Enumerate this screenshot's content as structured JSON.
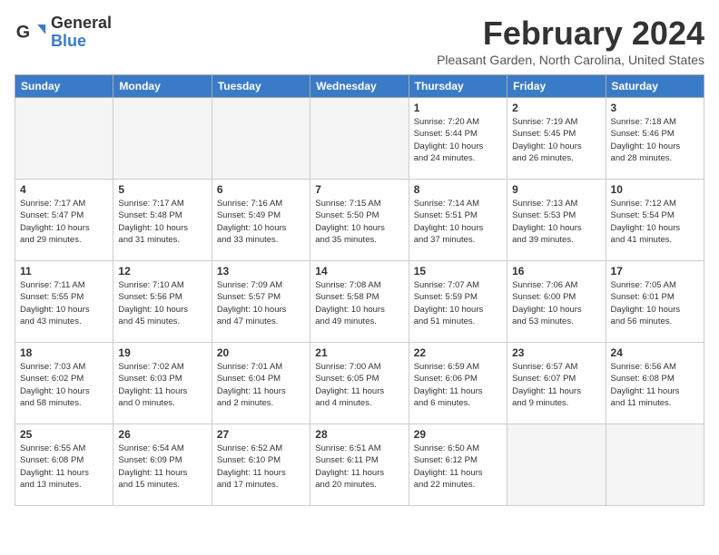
{
  "header": {
    "logo_general": "General",
    "logo_blue": "Blue",
    "month_title": "February 2024",
    "location": "Pleasant Garden, North Carolina, United States"
  },
  "days_of_week": [
    "Sunday",
    "Monday",
    "Tuesday",
    "Wednesday",
    "Thursday",
    "Friday",
    "Saturday"
  ],
  "weeks": [
    [
      {
        "num": "",
        "info": ""
      },
      {
        "num": "",
        "info": ""
      },
      {
        "num": "",
        "info": ""
      },
      {
        "num": "",
        "info": ""
      },
      {
        "num": "1",
        "info": "Sunrise: 7:20 AM\nSunset: 5:44 PM\nDaylight: 10 hours\nand 24 minutes."
      },
      {
        "num": "2",
        "info": "Sunrise: 7:19 AM\nSunset: 5:45 PM\nDaylight: 10 hours\nand 26 minutes."
      },
      {
        "num": "3",
        "info": "Sunrise: 7:18 AM\nSunset: 5:46 PM\nDaylight: 10 hours\nand 28 minutes."
      }
    ],
    [
      {
        "num": "4",
        "info": "Sunrise: 7:17 AM\nSunset: 5:47 PM\nDaylight: 10 hours\nand 29 minutes."
      },
      {
        "num": "5",
        "info": "Sunrise: 7:17 AM\nSunset: 5:48 PM\nDaylight: 10 hours\nand 31 minutes."
      },
      {
        "num": "6",
        "info": "Sunrise: 7:16 AM\nSunset: 5:49 PM\nDaylight: 10 hours\nand 33 minutes."
      },
      {
        "num": "7",
        "info": "Sunrise: 7:15 AM\nSunset: 5:50 PM\nDaylight: 10 hours\nand 35 minutes."
      },
      {
        "num": "8",
        "info": "Sunrise: 7:14 AM\nSunset: 5:51 PM\nDaylight: 10 hours\nand 37 minutes."
      },
      {
        "num": "9",
        "info": "Sunrise: 7:13 AM\nSunset: 5:53 PM\nDaylight: 10 hours\nand 39 minutes."
      },
      {
        "num": "10",
        "info": "Sunrise: 7:12 AM\nSunset: 5:54 PM\nDaylight: 10 hours\nand 41 minutes."
      }
    ],
    [
      {
        "num": "11",
        "info": "Sunrise: 7:11 AM\nSunset: 5:55 PM\nDaylight: 10 hours\nand 43 minutes."
      },
      {
        "num": "12",
        "info": "Sunrise: 7:10 AM\nSunset: 5:56 PM\nDaylight: 10 hours\nand 45 minutes."
      },
      {
        "num": "13",
        "info": "Sunrise: 7:09 AM\nSunset: 5:57 PM\nDaylight: 10 hours\nand 47 minutes."
      },
      {
        "num": "14",
        "info": "Sunrise: 7:08 AM\nSunset: 5:58 PM\nDaylight: 10 hours\nand 49 minutes."
      },
      {
        "num": "15",
        "info": "Sunrise: 7:07 AM\nSunset: 5:59 PM\nDaylight: 10 hours\nand 51 minutes."
      },
      {
        "num": "16",
        "info": "Sunrise: 7:06 AM\nSunset: 6:00 PM\nDaylight: 10 hours\nand 53 minutes."
      },
      {
        "num": "17",
        "info": "Sunrise: 7:05 AM\nSunset: 6:01 PM\nDaylight: 10 hours\nand 56 minutes."
      }
    ],
    [
      {
        "num": "18",
        "info": "Sunrise: 7:03 AM\nSunset: 6:02 PM\nDaylight: 10 hours\nand 58 minutes."
      },
      {
        "num": "19",
        "info": "Sunrise: 7:02 AM\nSunset: 6:03 PM\nDaylight: 11 hours\nand 0 minutes."
      },
      {
        "num": "20",
        "info": "Sunrise: 7:01 AM\nSunset: 6:04 PM\nDaylight: 11 hours\nand 2 minutes."
      },
      {
        "num": "21",
        "info": "Sunrise: 7:00 AM\nSunset: 6:05 PM\nDaylight: 11 hours\nand 4 minutes."
      },
      {
        "num": "22",
        "info": "Sunrise: 6:59 AM\nSunset: 6:06 PM\nDaylight: 11 hours\nand 6 minutes."
      },
      {
        "num": "23",
        "info": "Sunrise: 6:57 AM\nSunset: 6:07 PM\nDaylight: 11 hours\nand 9 minutes."
      },
      {
        "num": "24",
        "info": "Sunrise: 6:56 AM\nSunset: 6:08 PM\nDaylight: 11 hours\nand 11 minutes."
      }
    ],
    [
      {
        "num": "25",
        "info": "Sunrise: 6:55 AM\nSunset: 6:08 PM\nDaylight: 11 hours\nand 13 minutes."
      },
      {
        "num": "26",
        "info": "Sunrise: 6:54 AM\nSunset: 6:09 PM\nDaylight: 11 hours\nand 15 minutes."
      },
      {
        "num": "27",
        "info": "Sunrise: 6:52 AM\nSunset: 6:10 PM\nDaylight: 11 hours\nand 17 minutes."
      },
      {
        "num": "28",
        "info": "Sunrise: 6:51 AM\nSunset: 6:11 PM\nDaylight: 11 hours\nand 20 minutes."
      },
      {
        "num": "29",
        "info": "Sunrise: 6:50 AM\nSunset: 6:12 PM\nDaylight: 11 hours\nand 22 minutes."
      },
      {
        "num": "",
        "info": ""
      },
      {
        "num": "",
        "info": ""
      }
    ]
  ]
}
